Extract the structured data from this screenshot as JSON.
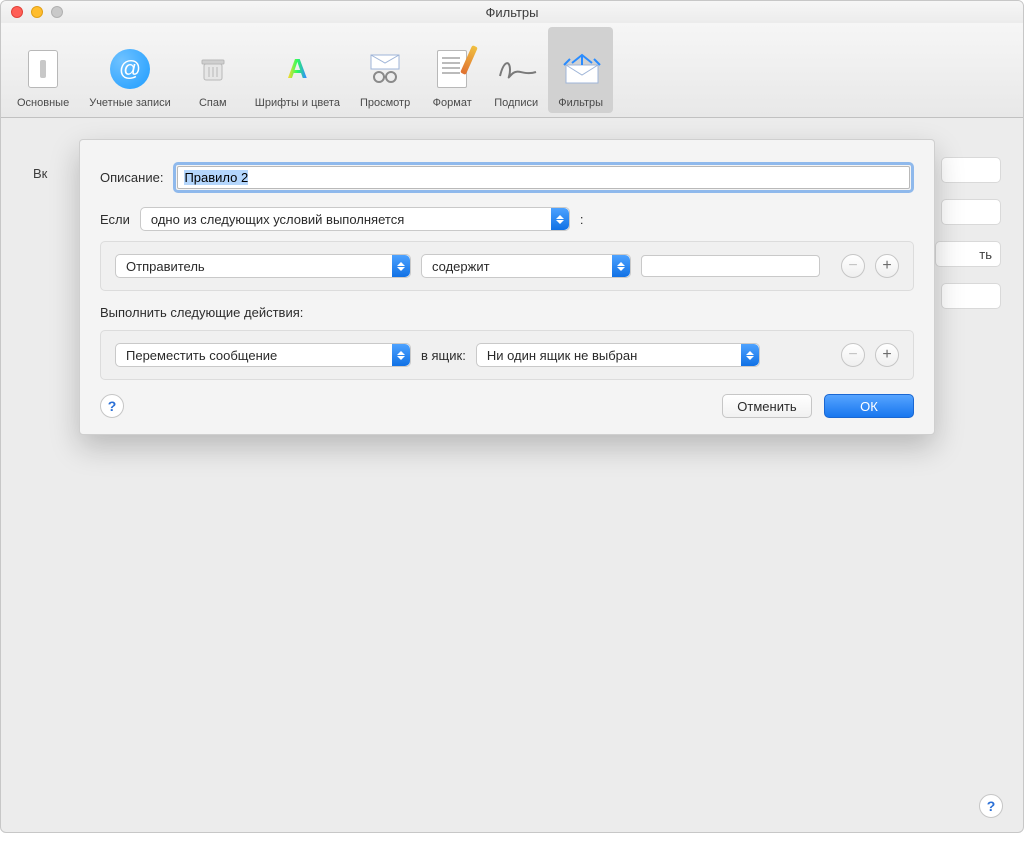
{
  "window": {
    "title": "Фильтры"
  },
  "toolbar": {
    "items": [
      {
        "id": "general",
        "label": "Основные"
      },
      {
        "id": "accounts",
        "label": "Учетные записи"
      },
      {
        "id": "spam",
        "label": "Спам"
      },
      {
        "id": "fonts",
        "label": "Шрифты и цвета"
      },
      {
        "id": "preview",
        "label": "Просмотр"
      },
      {
        "id": "format",
        "label": "Формат"
      },
      {
        "id": "sign",
        "label": "Подписи"
      },
      {
        "id": "filters",
        "label": "Фильтры"
      }
    ],
    "active": "filters"
  },
  "background": {
    "enabled_column": "Вк",
    "peek_button": "ть"
  },
  "sheet": {
    "description_label": "Описание:",
    "description_value": "Правило 2",
    "if_label": "Если",
    "if_match_scope": "одно из следующих условий выполняется",
    "colon": ":",
    "condition": {
      "field": "Отправитель",
      "operator": "содержит",
      "value": ""
    },
    "actions_label": "Выполнить следующие действия:",
    "action": {
      "type": "Переместить сообщение",
      "mailbox_label": "в ящик:",
      "mailbox_value": "Ни один ящик не выбран"
    },
    "cancel": "Отменить",
    "ok": "ОК",
    "help": "?"
  }
}
